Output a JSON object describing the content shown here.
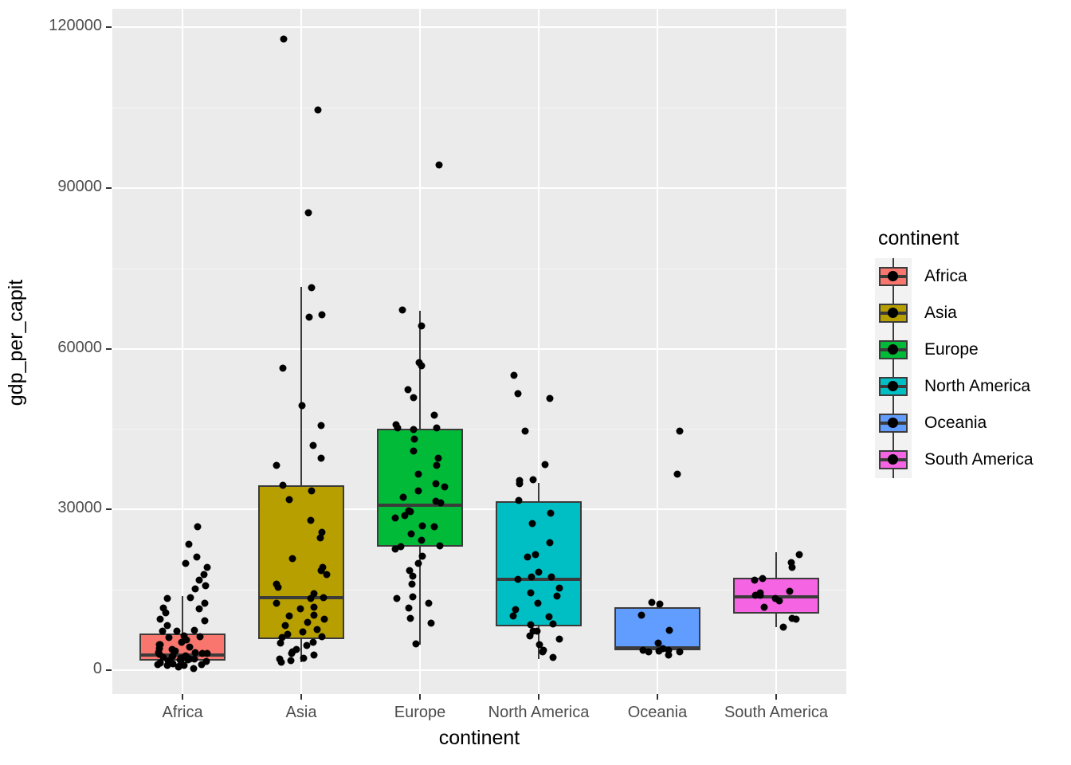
{
  "axes": {
    "x_title": "continent",
    "y_title": "gdp_per_capit",
    "x_ticks": [
      "Africa",
      "Asia",
      "Europe",
      "North America",
      "Oceania",
      "South America"
    ],
    "y_ticks": [
      "0",
      "30000",
      "60000",
      "90000",
      "120000"
    ]
  },
  "legend": {
    "title": "continent",
    "items": [
      {
        "label": "Africa",
        "color": "#F8766D"
      },
      {
        "label": "Asia",
        "color": "#B79F00"
      },
      {
        "label": "Europe",
        "color": "#00BA38"
      },
      {
        "label": "North America",
        "color": "#00BFC4"
      },
      {
        "label": "Oceania",
        "color": "#619CFF"
      },
      {
        "label": "South America",
        "color": "#F564E3"
      }
    ]
  },
  "chart_data": {
    "type": "boxplot",
    "title": "",
    "xlabel": "continent",
    "ylabel": "gdp_per_capit",
    "ylim": [
      -5000,
      123000
    ],
    "y_ticks": [
      0,
      30000,
      60000,
      90000,
      120000
    ],
    "y_minor_ticks": [
      15000,
      45000,
      75000,
      105000
    ],
    "grid": true,
    "legend_position": "right",
    "categories": [
      "Africa",
      "Asia",
      "Europe",
      "North America",
      "Oceania",
      "South America"
    ],
    "colors": [
      "#F8766D",
      "#B79F00",
      "#00BA38",
      "#00BFC4",
      "#619CFF",
      "#F564E3"
    ],
    "boxes": [
      {
        "category": "Africa",
        "color": "#F8766D",
        "lower_whisker": 600,
        "q1": 1800,
        "median": 2800,
        "q3": 6800,
        "upper_whisker": 13800,
        "points": [
          26600,
          23200,
          21200,
          19900,
          18800,
          17900,
          16400,
          15500,
          14900,
          13800,
          13300,
          12800,
          12100,
          11300,
          10300,
          9600,
          9100,
          8400,
          7900,
          7400,
          7000,
          6600,
          6300,
          5900,
          5500,
          5200,
          4900,
          4600,
          4300,
          4100,
          3900,
          3700,
          3500,
          3300,
          3100,
          3000,
          2900,
          2800,
          2700,
          2600,
          2500,
          2400,
          2300,
          2200,
          2100,
          2000,
          1900,
          1800,
          1700,
          1600,
          1500,
          1400,
          1300,
          1200,
          1100,
          1000,
          900,
          800,
          700,
          600
        ]
      },
      {
        "category": "Asia",
        "color": "#B79F00",
        "lower_whisker": 1500,
        "q1": 5800,
        "median": 13500,
        "q3": 34500,
        "upper_whisker": 71500,
        "points": [
          117500,
          105000,
          85000,
          71500,
          66000,
          65500,
          56000,
          49500,
          45500,
          42000,
          40000,
          38500,
          34500,
          33000,
          32000,
          28000,
          26000,
          24500,
          20500,
          19500,
          18500,
          17500,
          16500,
          15500,
          14500,
          13500,
          13000,
          12500,
          12000,
          11000,
          10500,
          9800,
          9200,
          8600,
          8000,
          7500,
          7000,
          6500,
          6100,
          5700,
          5300,
          4900,
          4500,
          4100,
          3700,
          3300,
          2900,
          2500,
          2100,
          1700,
          1500
        ]
      },
      {
        "category": "Europe",
        "color": "#00BA38",
        "lower_whisker": 4700,
        "q1": 23000,
        "median": 30800,
        "q3": 45000,
        "upper_whisker": 67000,
        "points": [
          94000,
          67000,
          64500,
          57500,
          56500,
          52000,
          50500,
          47500,
          46000,
          45500,
          45000,
          44500,
          43000,
          41000,
          39500,
          38000,
          36500,
          35000,
          34000,
          33000,
          32500,
          31500,
          30800,
          30000,
          29500,
          28500,
          28000,
          27000,
          26500,
          25500,
          24500,
          23500,
          23000,
          22500,
          21500,
          20000,
          18500,
          17500,
          16500,
          14000,
          13000,
          12500,
          11500,
          9200,
          8500,
          4700
        ]
      },
      {
        "category": "North America",
        "color": "#00BFC4",
        "lower_whisker": 2100,
        "q1": 8200,
        "median": 17000,
        "q3": 31500,
        "upper_whisker": 35000,
        "points": [
          55000,
          52000,
          50500,
          44500,
          38500,
          36000,
          35000,
          34500,
          31500,
          29000,
          27000,
          24000,
          22000,
          21500,
          18500,
          17500,
          17000,
          16500,
          15500,
          14500,
          13500,
          12500,
          11500,
          10500,
          9500,
          8800,
          8200,
          7500,
          7000,
          6500,
          5500,
          4700,
          4000,
          3300,
          2100
        ]
      },
      {
        "category": "Oceania",
        "color": "#619CFF",
        "lower_whisker": 2900,
        "q1": 3700,
        "median": 4200,
        "q3": 11700,
        "upper_whisker": 12500,
        "points": [
          45000,
          36400,
          12800,
          12700,
          9900,
          7000,
          4600,
          4500,
          4100,
          4000,
          3800,
          3400,
          3200,
          2900
        ]
      },
      {
        "category": "South America",
        "color": "#F564E3",
        "lower_whisker": 8000,
        "q1": 10500,
        "median": 13700,
        "q3": 17300,
        "upper_whisker": 22000,
        "points": [
          22000,
          19800,
          18800,
          17500,
          16500,
          14700,
          14300,
          13900,
          13500,
          13000,
          12900,
          11600,
          9900,
          9200,
          8000
        ]
      }
    ]
  }
}
